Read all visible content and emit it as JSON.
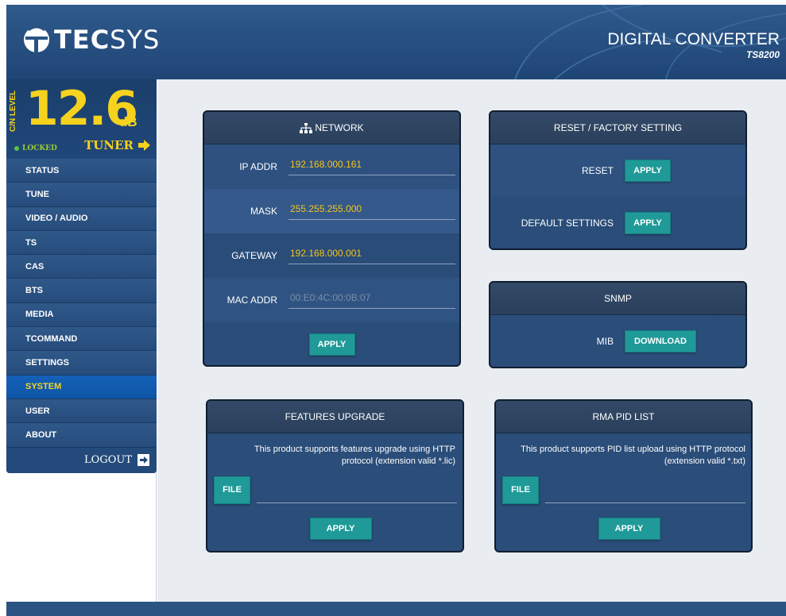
{
  "header": {
    "logo_bold": "TEC",
    "logo_light": "SYS",
    "product_name": "DIGITAL CONVERTER",
    "product_model": "TS8200"
  },
  "signal": {
    "label": "C/N LEVEL",
    "value": "12.6",
    "unit": "dB",
    "status": "LOCKED",
    "tuner_label": "TUNER"
  },
  "sidebar": {
    "items": [
      {
        "label": "STATUS",
        "active": false
      },
      {
        "label": "TUNE",
        "active": false
      },
      {
        "label": "VIDEO / AUDIO",
        "active": false
      },
      {
        "label": "TS",
        "active": false
      },
      {
        "label": "CAS",
        "active": false
      },
      {
        "label": "BTS",
        "active": false
      },
      {
        "label": "MEDIA",
        "active": false
      },
      {
        "label": "TCOMMAND",
        "active": false
      },
      {
        "label": "SETTINGS",
        "active": false
      },
      {
        "label": "SYSTEM",
        "active": true
      },
      {
        "label": "USER",
        "active": false
      },
      {
        "label": "ABOUT",
        "active": false
      }
    ],
    "logout_label": "LOGOUT"
  },
  "network": {
    "title": "NETWORK",
    "ip_label": "IP ADDR",
    "ip_value": "192.168.000.161",
    "mask_label": "MASK",
    "mask_value": "255.255.255.000",
    "gateway_label": "GATEWAY",
    "gateway_value": "192.168.000.001",
    "mac_label": "MAC ADDR",
    "mac_value": "00:E0:4C:00:0B:07",
    "apply_label": "APPLY"
  },
  "reset": {
    "title": "RESET / FACTORY SETTING",
    "reset_label": "RESET",
    "reset_button": "APPLY",
    "default_label": "DEFAULT SETTINGS",
    "default_button": "APPLY"
  },
  "snmp": {
    "title": "SNMP",
    "mib_label": "MIB",
    "download_button": "DOWNLOAD"
  },
  "features": {
    "title": "FEATURES UPGRADE",
    "description_line1": "This product supports features upgrade using HTTP",
    "description_line2": "protocol (extension valid *.lic)",
    "file_button": "FILE",
    "file_value": "",
    "apply_button": "APPLY"
  },
  "rma": {
    "title": "RMA PID LIST",
    "description_line1": "This product supports PID list upload using HTTP protocol",
    "description_line2": "(extension valid *.txt)",
    "file_button": "FILE",
    "file_value": "",
    "apply_button": "APPLY"
  },
  "colors": {
    "accent_yellow": "#f5d21e",
    "button_teal": "#1f9a98",
    "active_nav": "#1461b8",
    "panel_bg": "#2a4d79"
  }
}
